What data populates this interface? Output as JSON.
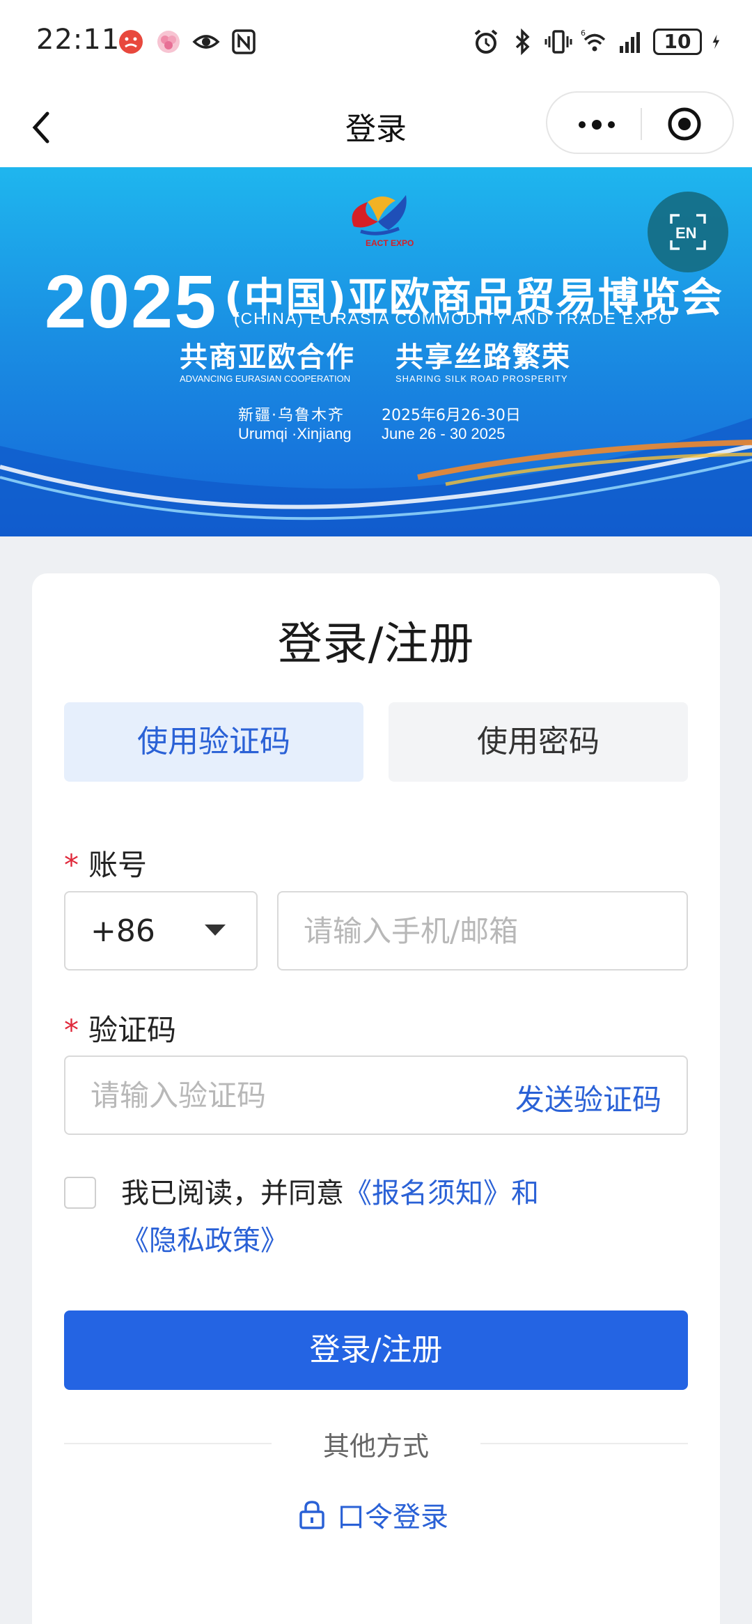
{
  "status_bar": {
    "time": "22:11",
    "battery": "10",
    "icons": [
      "angry-face-icon",
      "flower-icon",
      "eye-icon",
      "nfc-icon",
      "alarm-icon",
      "bluetooth-icon",
      "vibrate-icon",
      "wifi-6-icon",
      "signal-icon",
      "charging-icon"
    ]
  },
  "nav": {
    "title": "登录"
  },
  "banner": {
    "logo_text": "EACT EXPO",
    "year": "2025",
    "title": "(中国)亚欧商品贸易博览会",
    "subtitle_en": "(CHINA) EURASIA COMMODITY AND TRADE EXPO",
    "slogan_1": "共商亚欧合作",
    "slogan_1_en": "ADVANCING EURASIAN COOPERATION",
    "slogan_2": "共享丝路繁荣",
    "slogan_2_en": "SHARING SILK ROAD PROSPERITY",
    "venue_cn": "新疆·乌鲁木齐",
    "venue_en": "Urumqi ·Xinjiang",
    "date_cn": "2025年6月26-30日",
    "date_en": "June 26 - 30  2025",
    "lang_toggle": "EN"
  },
  "login": {
    "title": "登录/注册",
    "tabs": [
      {
        "label": "使用验证码",
        "active": true
      },
      {
        "label": "使用密码",
        "active": false
      }
    ],
    "account_label": "账号",
    "country_code": "+86",
    "account_placeholder": "请输入手机/邮箱",
    "code_label": "验证码",
    "code_placeholder": "请输入验证码",
    "send_code": "发送验证码",
    "agree_prefix": "我已阅读，并同意",
    "agree_link_1": "《报名须知》",
    "agree_and": "和",
    "agree_link_2": "《隐私政策》",
    "submit": "登录/注册",
    "other_methods": "其他方式",
    "token_login": "口令登录"
  },
  "colors": {
    "accent": "#2464e3",
    "link": "#2a61d6",
    "required": "#e0293b"
  }
}
